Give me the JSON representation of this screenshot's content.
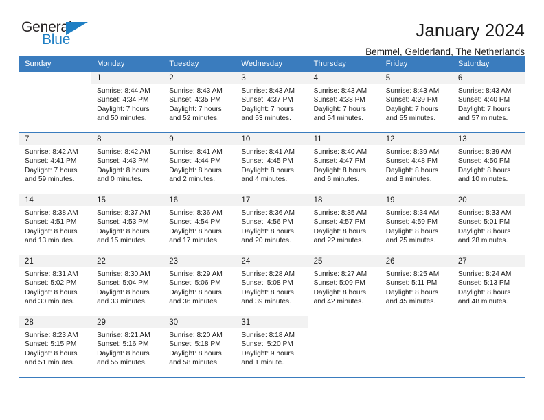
{
  "brand": {
    "name_part1": "General",
    "name_part2": "Blue",
    "triangle_color": "#1f7fc4"
  },
  "header": {
    "title": "January 2024",
    "subtitle": "Bemmel, Gelderland, The Netherlands"
  },
  "theme": {
    "header_bg": "#3a7cbe",
    "daynum_bg": "#f2f2f2",
    "text": "#1a1a1a"
  },
  "weekday_headers": [
    "Sunday",
    "Monday",
    "Tuesday",
    "Wednesday",
    "Thursday",
    "Friday",
    "Saturday"
  ],
  "labels": {
    "sunrise_prefix": "Sunrise:",
    "sunset_prefix": "Sunset:",
    "daylight_prefix": "Daylight:"
  },
  "weeks": [
    [
      {
        "day": "",
        "line1": "",
        "line2": "",
        "line3": "",
        "line4": ""
      },
      {
        "day": "1",
        "line1": "Sunrise: 8:44 AM",
        "line2": "Sunset: 4:34 PM",
        "line3": "Daylight: 7 hours",
        "line4": "and 50 minutes."
      },
      {
        "day": "2",
        "line1": "Sunrise: 8:43 AM",
        "line2": "Sunset: 4:35 PM",
        "line3": "Daylight: 7 hours",
        "line4": "and 52 minutes."
      },
      {
        "day": "3",
        "line1": "Sunrise: 8:43 AM",
        "line2": "Sunset: 4:37 PM",
        "line3": "Daylight: 7 hours",
        "line4": "and 53 minutes."
      },
      {
        "day": "4",
        "line1": "Sunrise: 8:43 AM",
        "line2": "Sunset: 4:38 PM",
        "line3": "Daylight: 7 hours",
        "line4": "and 54 minutes."
      },
      {
        "day": "5",
        "line1": "Sunrise: 8:43 AM",
        "line2": "Sunset: 4:39 PM",
        "line3": "Daylight: 7 hours",
        "line4": "and 55 minutes."
      },
      {
        "day": "6",
        "line1": "Sunrise: 8:43 AM",
        "line2": "Sunset: 4:40 PM",
        "line3": "Daylight: 7 hours",
        "line4": "and 57 minutes."
      }
    ],
    [
      {
        "day": "7",
        "line1": "Sunrise: 8:42 AM",
        "line2": "Sunset: 4:41 PM",
        "line3": "Daylight: 7 hours",
        "line4": "and 59 minutes."
      },
      {
        "day": "8",
        "line1": "Sunrise: 8:42 AM",
        "line2": "Sunset: 4:43 PM",
        "line3": "Daylight: 8 hours",
        "line4": "and 0 minutes."
      },
      {
        "day": "9",
        "line1": "Sunrise: 8:41 AM",
        "line2": "Sunset: 4:44 PM",
        "line3": "Daylight: 8 hours",
        "line4": "and 2 minutes."
      },
      {
        "day": "10",
        "line1": "Sunrise: 8:41 AM",
        "line2": "Sunset: 4:45 PM",
        "line3": "Daylight: 8 hours",
        "line4": "and 4 minutes."
      },
      {
        "day": "11",
        "line1": "Sunrise: 8:40 AM",
        "line2": "Sunset: 4:47 PM",
        "line3": "Daylight: 8 hours",
        "line4": "and 6 minutes."
      },
      {
        "day": "12",
        "line1": "Sunrise: 8:39 AM",
        "line2": "Sunset: 4:48 PM",
        "line3": "Daylight: 8 hours",
        "line4": "and 8 minutes."
      },
      {
        "day": "13",
        "line1": "Sunrise: 8:39 AM",
        "line2": "Sunset: 4:50 PM",
        "line3": "Daylight: 8 hours",
        "line4": "and 10 minutes."
      }
    ],
    [
      {
        "day": "14",
        "line1": "Sunrise: 8:38 AM",
        "line2": "Sunset: 4:51 PM",
        "line3": "Daylight: 8 hours",
        "line4": "and 13 minutes."
      },
      {
        "day": "15",
        "line1": "Sunrise: 8:37 AM",
        "line2": "Sunset: 4:53 PM",
        "line3": "Daylight: 8 hours",
        "line4": "and 15 minutes."
      },
      {
        "day": "16",
        "line1": "Sunrise: 8:36 AM",
        "line2": "Sunset: 4:54 PM",
        "line3": "Daylight: 8 hours",
        "line4": "and 17 minutes."
      },
      {
        "day": "17",
        "line1": "Sunrise: 8:36 AM",
        "line2": "Sunset: 4:56 PM",
        "line3": "Daylight: 8 hours",
        "line4": "and 20 minutes."
      },
      {
        "day": "18",
        "line1": "Sunrise: 8:35 AM",
        "line2": "Sunset: 4:57 PM",
        "line3": "Daylight: 8 hours",
        "line4": "and 22 minutes."
      },
      {
        "day": "19",
        "line1": "Sunrise: 8:34 AM",
        "line2": "Sunset: 4:59 PM",
        "line3": "Daylight: 8 hours",
        "line4": "and 25 minutes."
      },
      {
        "day": "20",
        "line1": "Sunrise: 8:33 AM",
        "line2": "Sunset: 5:01 PM",
        "line3": "Daylight: 8 hours",
        "line4": "and 28 minutes."
      }
    ],
    [
      {
        "day": "21",
        "line1": "Sunrise: 8:31 AM",
        "line2": "Sunset: 5:02 PM",
        "line3": "Daylight: 8 hours",
        "line4": "and 30 minutes."
      },
      {
        "day": "22",
        "line1": "Sunrise: 8:30 AM",
        "line2": "Sunset: 5:04 PM",
        "line3": "Daylight: 8 hours",
        "line4": "and 33 minutes."
      },
      {
        "day": "23",
        "line1": "Sunrise: 8:29 AM",
        "line2": "Sunset: 5:06 PM",
        "line3": "Daylight: 8 hours",
        "line4": "and 36 minutes."
      },
      {
        "day": "24",
        "line1": "Sunrise: 8:28 AM",
        "line2": "Sunset: 5:08 PM",
        "line3": "Daylight: 8 hours",
        "line4": "and 39 minutes."
      },
      {
        "day": "25",
        "line1": "Sunrise: 8:27 AM",
        "line2": "Sunset: 5:09 PM",
        "line3": "Daylight: 8 hours",
        "line4": "and 42 minutes."
      },
      {
        "day": "26",
        "line1": "Sunrise: 8:25 AM",
        "line2": "Sunset: 5:11 PM",
        "line3": "Daylight: 8 hours",
        "line4": "and 45 minutes."
      },
      {
        "day": "27",
        "line1": "Sunrise: 8:24 AM",
        "line2": "Sunset: 5:13 PM",
        "line3": "Daylight: 8 hours",
        "line4": "and 48 minutes."
      }
    ],
    [
      {
        "day": "28",
        "line1": "Sunrise: 8:23 AM",
        "line2": "Sunset: 5:15 PM",
        "line3": "Daylight: 8 hours",
        "line4": "and 51 minutes."
      },
      {
        "day": "29",
        "line1": "Sunrise: 8:21 AM",
        "line2": "Sunset: 5:16 PM",
        "line3": "Daylight: 8 hours",
        "line4": "and 55 minutes."
      },
      {
        "day": "30",
        "line1": "Sunrise: 8:20 AM",
        "line2": "Sunset: 5:18 PM",
        "line3": "Daylight: 8 hours",
        "line4": "and 58 minutes."
      },
      {
        "day": "31",
        "line1": "Sunrise: 8:18 AM",
        "line2": "Sunset: 5:20 PM",
        "line3": "Daylight: 9 hours",
        "line4": "and 1 minute."
      },
      {
        "day": "",
        "line1": "",
        "line2": "",
        "line3": "",
        "line4": ""
      },
      {
        "day": "",
        "line1": "",
        "line2": "",
        "line3": "",
        "line4": ""
      },
      {
        "day": "",
        "line1": "",
        "line2": "",
        "line3": "",
        "line4": ""
      }
    ]
  ]
}
